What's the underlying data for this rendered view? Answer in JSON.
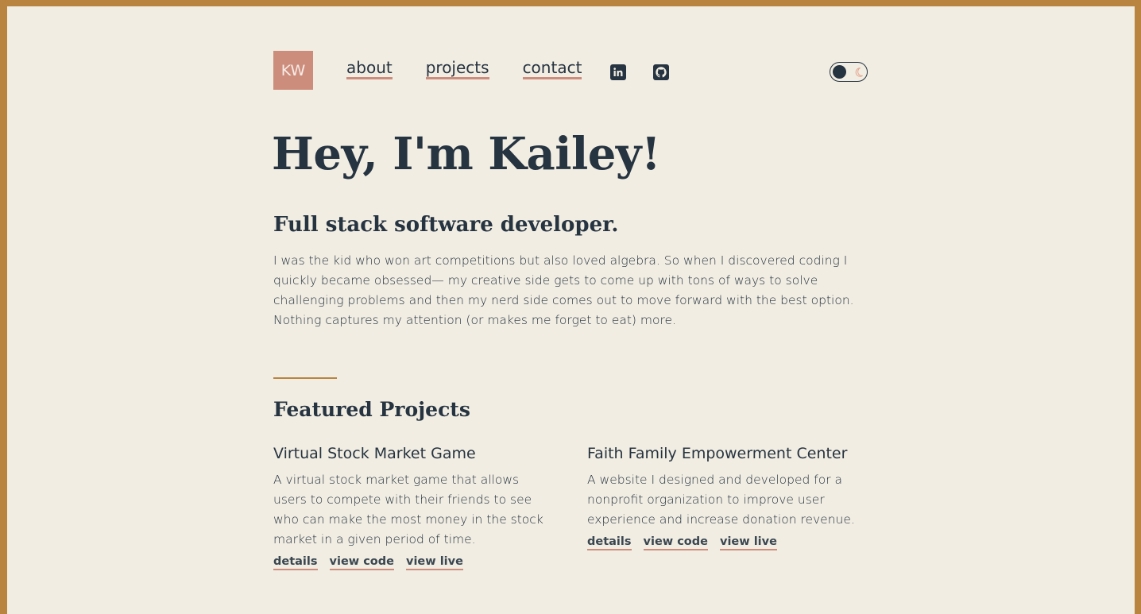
{
  "header": {
    "logo": "KW",
    "nav": [
      {
        "label": "about"
      },
      {
        "label": "projects"
      },
      {
        "label": "contact"
      }
    ],
    "social_icons": [
      "linkedin-icon",
      "github-icon"
    ],
    "theme_toggle_icon": "moon-icon"
  },
  "hero": {
    "title": "Hey, I'm Kailey!",
    "subtitle": "Full stack software developer.",
    "intro": "I was the kid who won art competitions but also loved algebra. So when I discovered coding I quickly became obsessed— my creative side gets to come up with tons of ways to solve challenging problems and then my nerd side comes out to move forward with the best option. Nothing captures my attention (or makes me forget to eat) more."
  },
  "featured": {
    "title": "Featured Projects",
    "projects": [
      {
        "title": "Virtual Stock Market Game",
        "description": "A virtual stock market game that allows users to compete with their friends to see who can make the most money in the stock market in a given period of time.",
        "links": [
          "details",
          "view code",
          "view live"
        ]
      },
      {
        "title": "Faith Family Empowerment Center",
        "description": "A website I designed and developed for a nonprofit organization to improve user experience and increase donation revenue.",
        "links": [
          "details",
          "view code",
          "view live"
        ]
      }
    ]
  },
  "colors": {
    "background": "#f1ede2",
    "frame": "#b8843f",
    "text": "#263340",
    "accent": "#cc8d7c"
  }
}
